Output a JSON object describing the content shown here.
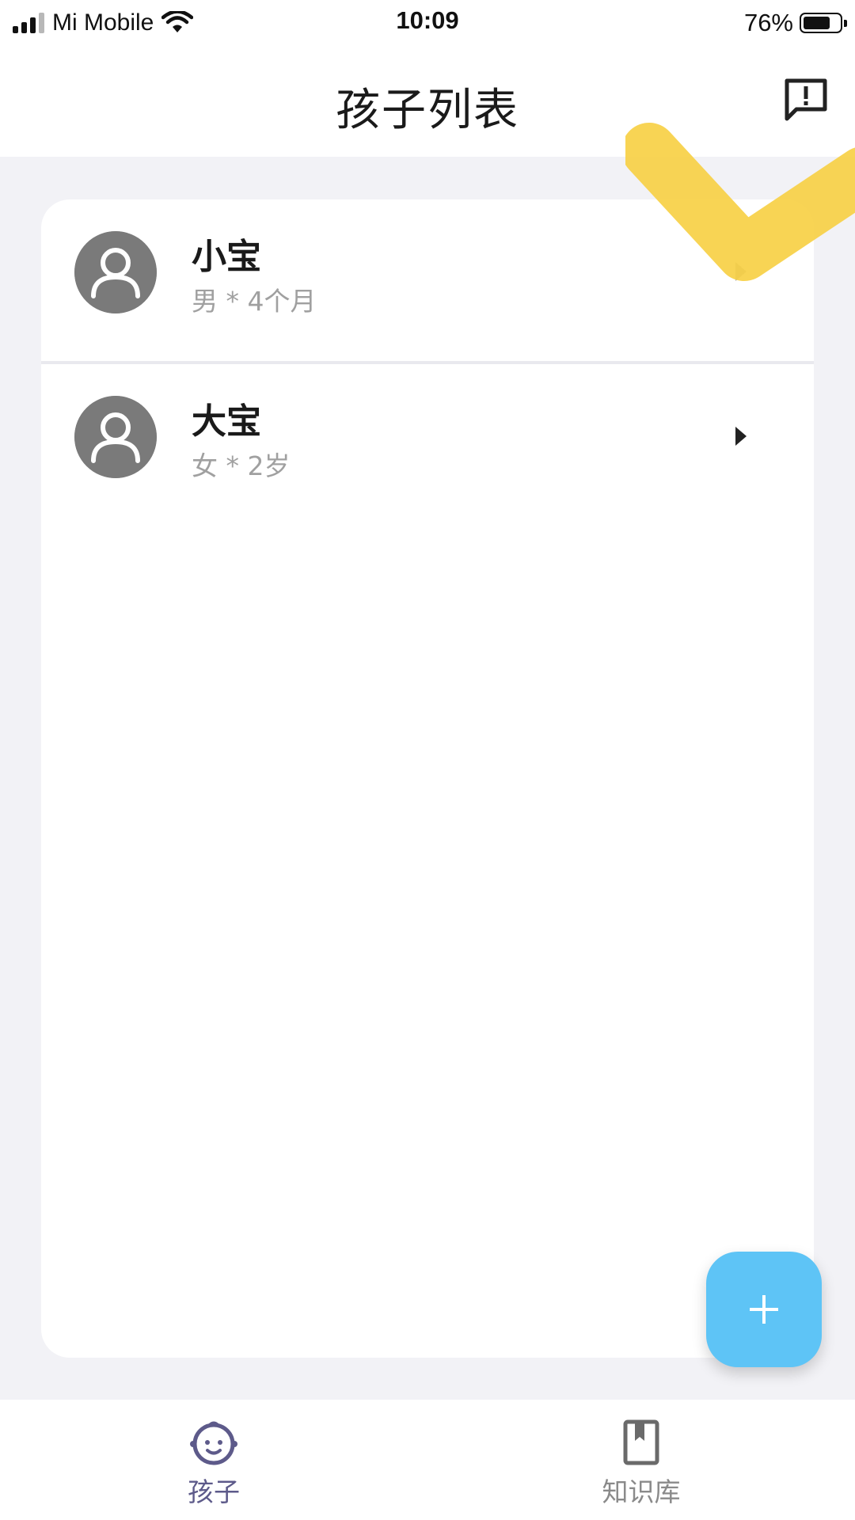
{
  "status_bar": {
    "carrier": "Mi Mobile",
    "time": "10:09",
    "battery_percent": "76%",
    "battery_level": 0.76,
    "signal_bars_active": 3,
    "signal_bars_total": 4
  },
  "header": {
    "title": "孩子列表",
    "feedback_icon": "feedback-alert-icon"
  },
  "children": [
    {
      "name": "小宝",
      "detail": "男 * 4个月"
    },
    {
      "name": "大宝",
      "detail": "女 * 2岁"
    }
  ],
  "fab": {
    "icon": "plus-icon"
  },
  "tabs": [
    {
      "label": "孩子",
      "icon": "baby-face-icon",
      "active": true
    },
    {
      "label": "知识库",
      "icon": "book-icon",
      "active": false
    }
  ],
  "colors": {
    "accent": "#5ec4f6",
    "active_tab": "#5d5a8a",
    "inactive_tab": "#8a8a8a",
    "background": "#f2f2f6",
    "avatar": "#7a7a7a"
  }
}
